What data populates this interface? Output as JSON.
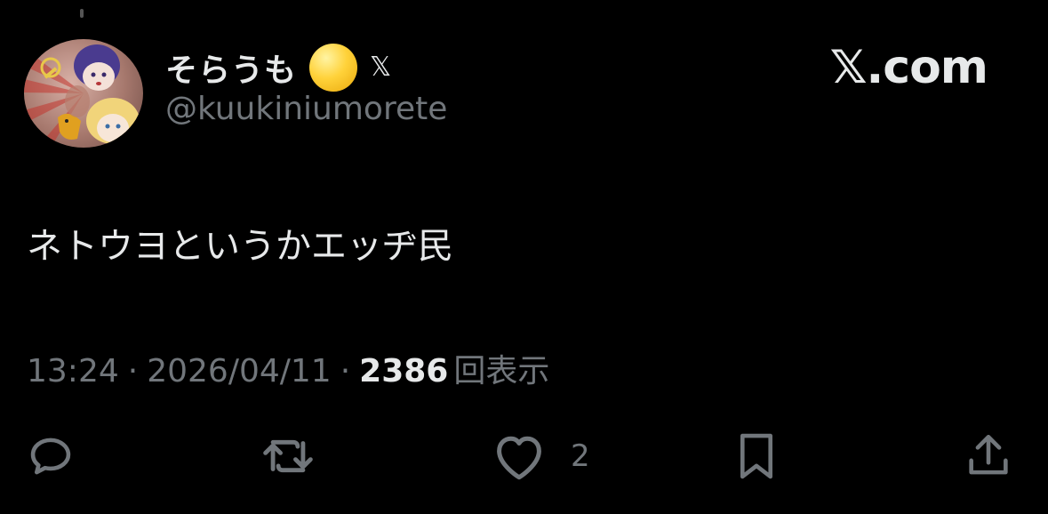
{
  "user": {
    "display_name": "そらうも",
    "emoji": "yellow-circle",
    "badge": "𝕏",
    "handle": "@kuukiniumorete"
  },
  "brand": {
    "label": "𝕏.com"
  },
  "tweet": {
    "text": "ネトウヨというかエッヂ民"
  },
  "meta": {
    "time": "13:24",
    "separator": "·",
    "date": "2026/04/11",
    "views_count": "2386",
    "views_label": "回表示"
  },
  "actions": {
    "reply": {
      "icon": "reply-icon"
    },
    "retweet": {
      "icon": "retweet-icon"
    },
    "like": {
      "icon": "heart-icon",
      "count": "2"
    },
    "bookmark": {
      "icon": "bookmark-icon"
    },
    "share": {
      "icon": "share-icon"
    }
  },
  "colors": {
    "background": "#000000",
    "text_primary": "#e7e9ea",
    "text_secondary": "#71767b",
    "emoji_yellow": "#ffd23a"
  }
}
